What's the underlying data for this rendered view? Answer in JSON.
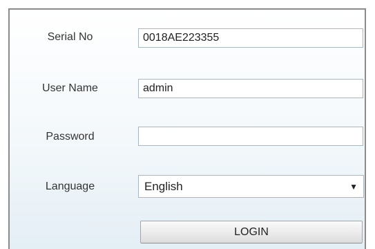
{
  "login_form": {
    "serial_no": {
      "label": "Serial No",
      "value": "0018AE223355"
    },
    "user_name": {
      "label": "User Name",
      "value": "admin"
    },
    "password": {
      "label": "Password",
      "value": ""
    },
    "language": {
      "label": "Language",
      "selected": "English",
      "caret_icon": "triangle-down-icon"
    },
    "login_label": "LOGIN"
  }
}
